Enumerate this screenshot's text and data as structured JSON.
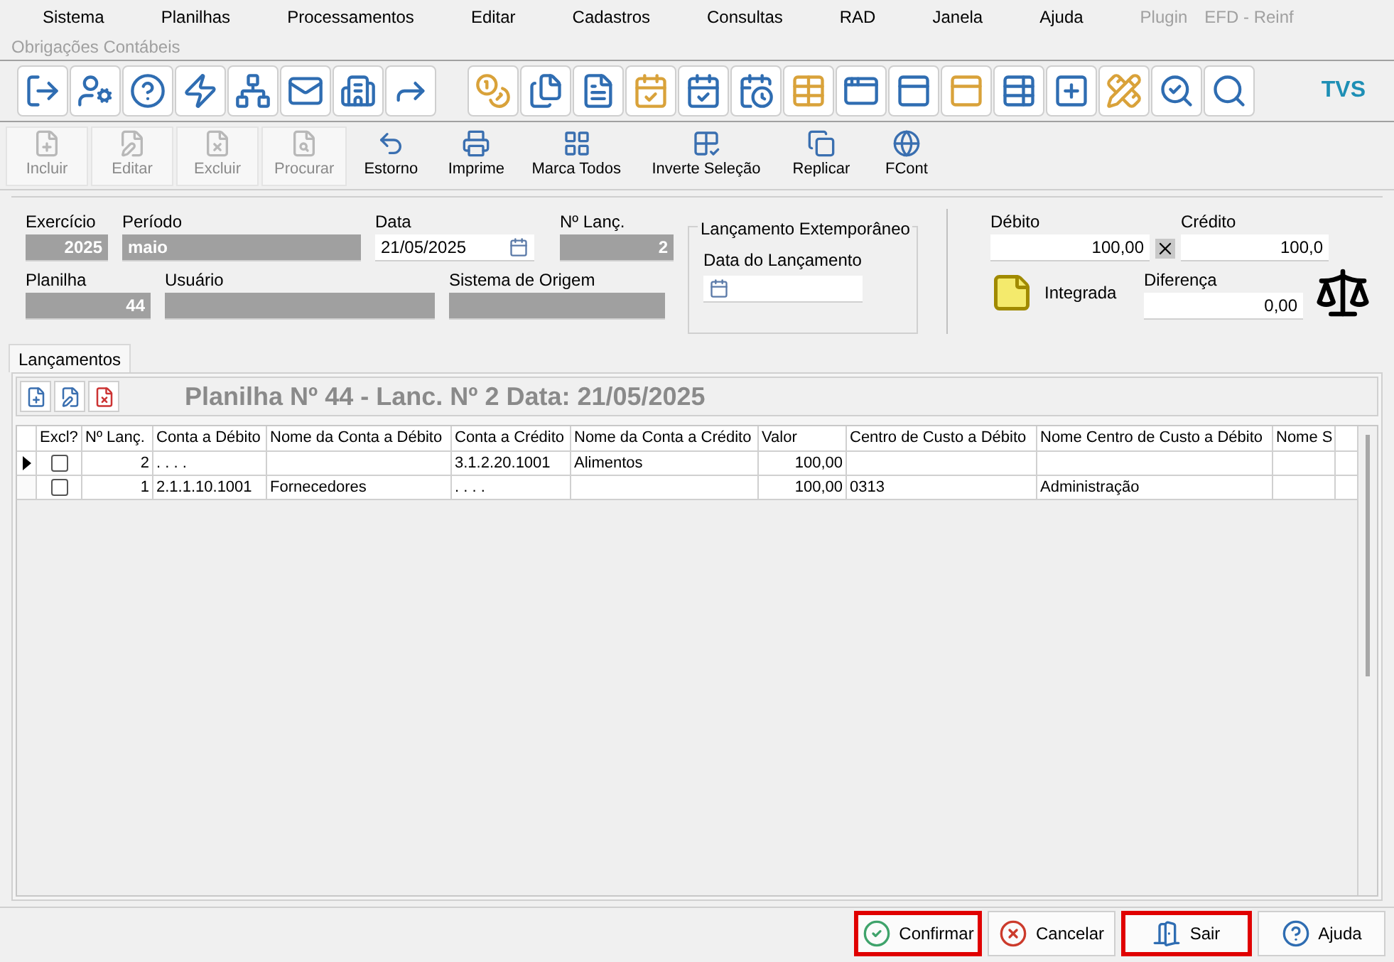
{
  "menu": [
    {
      "label": "Sistema",
      "disabled": false
    },
    {
      "label": "Planilhas",
      "disabled": false
    },
    {
      "label": "Processamentos",
      "disabled": false
    },
    {
      "label": "Editar",
      "disabled": false
    },
    {
      "label": "Cadastros",
      "disabled": false
    },
    {
      "label": "Consultas",
      "disabled": false
    },
    {
      "label": "RAD",
      "disabled": false
    },
    {
      "label": "Janela",
      "disabled": false
    },
    {
      "label": "Ajuda",
      "disabled": false
    },
    {
      "label": "Plugin",
      "disabled": true
    },
    {
      "label": "EFD - Reinf",
      "disabled": true
    }
  ],
  "subtitle": "Obrigações Contábeis",
  "logo_text": "TVS",
  "actions": [
    {
      "label": "Incluir",
      "disabled": true
    },
    {
      "label": "Editar",
      "disabled": true
    },
    {
      "label": "Excluir",
      "disabled": true
    },
    {
      "label": "Procurar",
      "disabled": true
    },
    {
      "label": "Estorno",
      "disabled": false
    },
    {
      "label": "Imprime",
      "disabled": false
    },
    {
      "label": "Marca Todos",
      "disabled": false
    },
    {
      "label": "Inverte Seleção",
      "disabled": false
    },
    {
      "label": "Replicar",
      "disabled": false
    },
    {
      "label": "FCont",
      "disabled": false
    }
  ],
  "form": {
    "exercicio": {
      "label": "Exercício",
      "value": "2025"
    },
    "periodo": {
      "label": "Período",
      "value": "maio"
    },
    "data": {
      "label": "Data",
      "value": "21/05/2025"
    },
    "lanc": {
      "label": "Nº Lanç.",
      "value": "2"
    },
    "planilha": {
      "label": "Planilha",
      "value": "44"
    },
    "usuario": {
      "label": "Usuário"
    },
    "sistema": {
      "label": "Sistema de Origem"
    }
  },
  "extemporaneo": {
    "title": "Lançamento Extemporâneo",
    "label": "Data do Lançamento"
  },
  "totals": {
    "debito_label": "Débito",
    "debito": "100,00",
    "credito_label": "Crédito",
    "credito": "100,0",
    "integrada": "Integrada",
    "diferenca_label": "Diferença",
    "diferenca": "0,00"
  },
  "tabs": [
    {
      "label": "Lançamentos",
      "selected": true
    }
  ],
  "grid_title": "Planilha Nº 44 - Lanc. Nº 2 Data: 21/05/2025",
  "table": {
    "columns": [
      "Excl?",
      "Nº Lanç.",
      "Conta a Débito",
      "Nome da Conta a Débito",
      "Conta a Crédito",
      "Nome da Conta a Crédito",
      "Valor",
      "Centro de Custo a Débito",
      "Nome Centro de Custo a Débito",
      "Nome S"
    ],
    "rows": [
      {
        "selected": true,
        "checked": false,
        "cells": [
          "",
          "2",
          ". . . .",
          "",
          "3.1.2.20.1001",
          "Alimentos",
          "100,00",
          "",
          "",
          ""
        ]
      },
      {
        "selected": false,
        "checked": false,
        "cells": [
          "",
          "1",
          "2.1.1.10.1001",
          "Fornecedores",
          ". . . .",
          "",
          "100,00",
          "0313",
          "Administração",
          ""
        ]
      }
    ]
  },
  "buttons": [
    {
      "label": "Confirmar",
      "kind": "confirm",
      "highlighted": true
    },
    {
      "label": "Cancelar",
      "kind": "cancel",
      "highlighted": false
    },
    {
      "label": "Sair",
      "kind": "exit",
      "highlighted": true
    },
    {
      "label": "Ajuda",
      "kind": "help",
      "highlighted": false
    }
  ]
}
